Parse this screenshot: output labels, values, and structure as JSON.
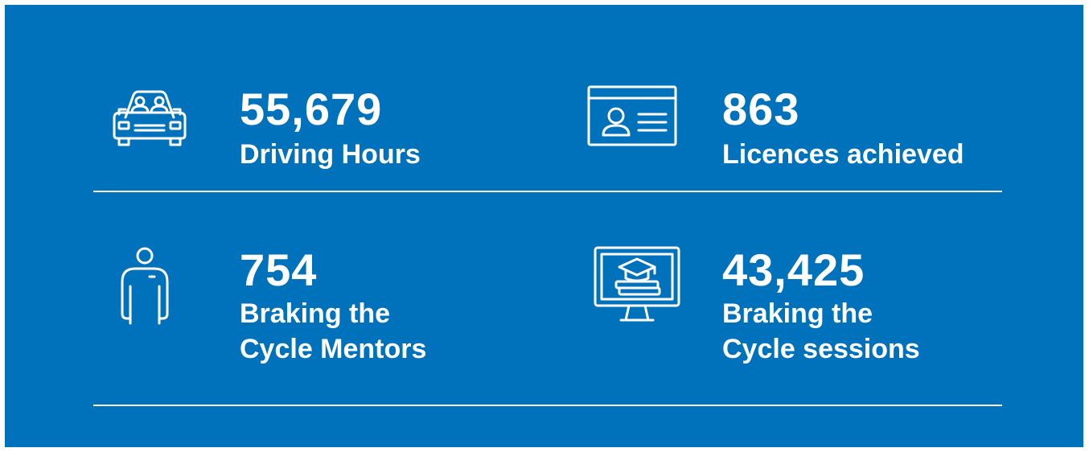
{
  "colors": {
    "background": "#0072bc",
    "foreground": "#ffffff"
  },
  "stats": [
    {
      "icon": "car-icon",
      "value": "55,679",
      "label_lines": [
        "Driving Hours"
      ]
    },
    {
      "icon": "id-card-icon",
      "value": "863",
      "label_lines": [
        "Licences achieved"
      ]
    },
    {
      "icon": "person-icon",
      "value": "754",
      "label_lines": [
        "Braking the",
        "Cycle Mentors"
      ]
    },
    {
      "icon": "online-learning-monitor-icon",
      "value": "43,425",
      "label_lines": [
        "Braking the",
        "Cycle sessions"
      ]
    }
  ]
}
